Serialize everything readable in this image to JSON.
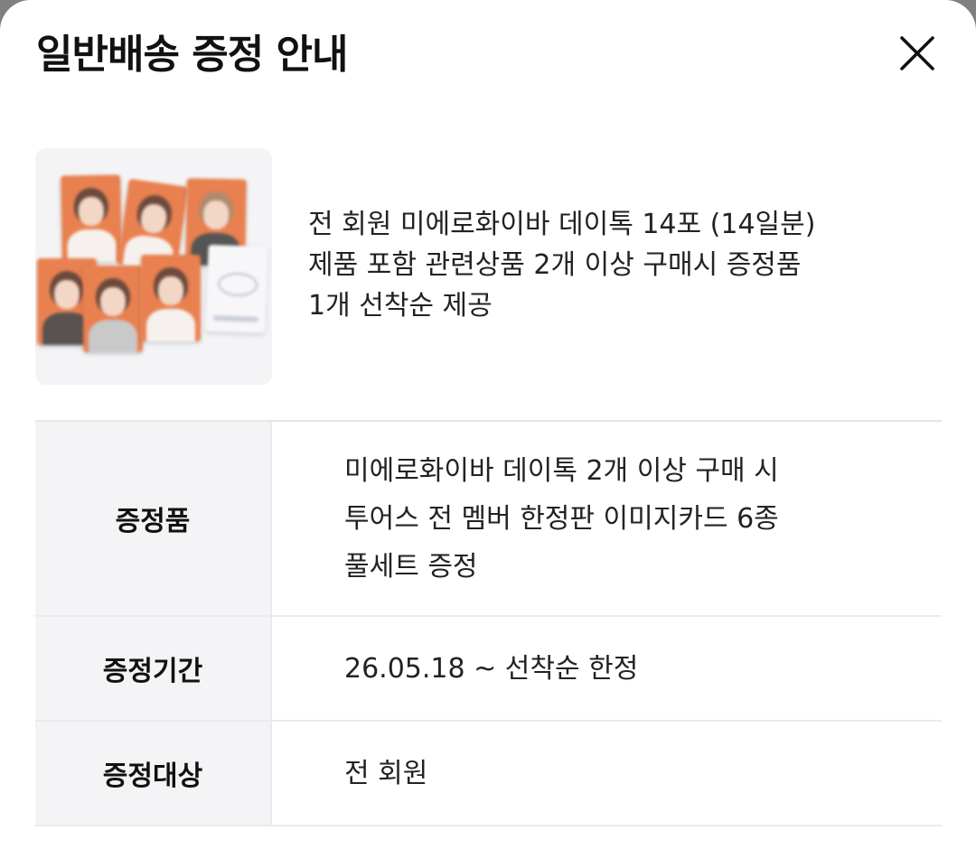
{
  "dialog": {
    "title": "일반배송 증정 안내",
    "close_icon": "close-icon"
  },
  "product": {
    "image_alt": "photo-card-set-thumbnail",
    "description_lines": [
      "전 회원 미에로화이바 데이톡 14포 (14일분)",
      "제품 포함 관련상품 2개 이상 구매시 증정품",
      "1개 선착순 제공"
    ]
  },
  "table": {
    "rows": [
      {
        "label": "증정품",
        "value_lines": [
          "미에로화이바 데이톡 2개 이상 구매 시",
          "투어스 전 멤버 한정판 이미지카드 6종",
          "풀세트 증정"
        ]
      },
      {
        "label": "증정기간",
        "value_lines": [
          "26.05.18 ~ 선착순 한정"
        ]
      },
      {
        "label": "증정대상",
        "value_lines": [
          "전 회원"
        ]
      }
    ]
  },
  "colors": {
    "card_orange": "#e9804f",
    "label_bg": "#f4f4f6",
    "text": "#222222"
  }
}
